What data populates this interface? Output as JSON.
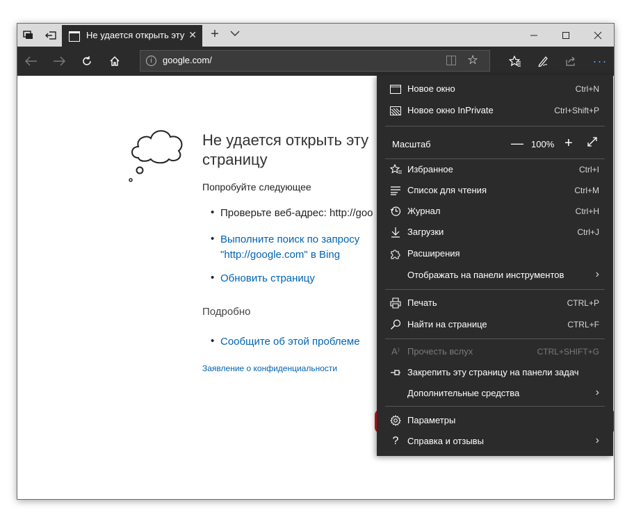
{
  "browser": {
    "tab_title": "Не удается открыть эту",
    "url": "google.com/"
  },
  "page": {
    "error_title": "Не удается открыть эту страницу",
    "try_heading": "Попробуйте следующее",
    "bullet_check_address": "Проверьте веб-адрес: http://goo",
    "bullet_search_line1": "Выполните поиск по запросу",
    "bullet_search_line2": "\"http://google.com\" в Bing",
    "bullet_refresh": "Обновить страницу",
    "more_info_heading": "Подробно",
    "bullet_report": "Сообщите об этой проблеме",
    "privacy_link": "Заявление о конфиденциальности"
  },
  "menu": {
    "new_window": {
      "label": "Новое окно",
      "shortcut": "Ctrl+N",
      "icon": "window-icon"
    },
    "new_inprivate": {
      "label": "Новое окно InPrivate",
      "shortcut": "Ctrl+Shift+P",
      "icon": "inprivate-icon"
    },
    "zoom": {
      "label": "Масштаб",
      "value": "100%"
    },
    "favorites": {
      "label": "Избранное",
      "shortcut": "Ctrl+I",
      "icon": "favorites-icon"
    },
    "reading_list": {
      "label": "Список для чтения",
      "shortcut": "Ctrl+M",
      "icon": "reading-list-icon"
    },
    "history": {
      "label": "Журнал",
      "shortcut": "Ctrl+H",
      "icon": "history-icon"
    },
    "downloads": {
      "label": "Загрузки",
      "shortcut": "Ctrl+J",
      "icon": "download-icon"
    },
    "extensions": {
      "label": "Расширения",
      "icon": "puzzle-icon"
    },
    "show_in_toolbar": {
      "label": "Отображать на панели инструментов"
    },
    "print": {
      "label": "Печать",
      "shortcut": "CTRL+P",
      "icon": "printer-icon"
    },
    "find": {
      "label": "Найти на странице",
      "shortcut": "CTRL+F",
      "icon": "search-icon"
    },
    "read_aloud": {
      "label": "Прочесть вслух",
      "shortcut": "CTRL+SHIFT+G",
      "icon": "read-aloud-icon"
    },
    "pin_taskbar": {
      "label": "Закрепить эту страницу на панели задач",
      "icon": "pin-icon"
    },
    "more_tools": {
      "label": "Дополнительные средства"
    },
    "settings": {
      "label": "Параметры",
      "icon": "gear-icon"
    },
    "help": {
      "label": "Справка и отзывы",
      "icon": "help-icon"
    }
  },
  "colors": {
    "toolbar_bg": "#2b2b2b",
    "link": "#0063b1",
    "highlight_border": "#e0141e",
    "more_button": "#4aa3f5"
  }
}
